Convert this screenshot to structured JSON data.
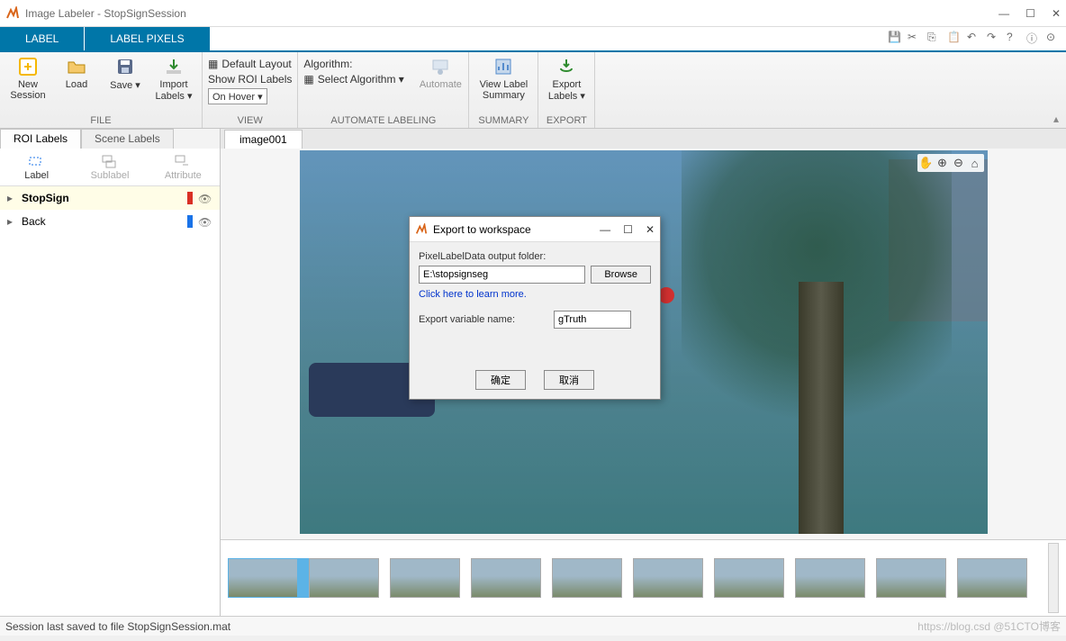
{
  "window": {
    "title": "Image Labeler - StopSignSession",
    "min": "—",
    "max": "☐",
    "close": "✕"
  },
  "tabs": {
    "label": "LABEL",
    "pixels": "LABEL PIXELS"
  },
  "ribbon": {
    "file": {
      "new": "New\nSession",
      "load": "Load",
      "save": "Save ▾",
      "import": "Import\nLabels ▾",
      "group": "FILE"
    },
    "view": {
      "default_layout": "Default Layout",
      "show_roi": "Show ROI Labels",
      "on_hover": "On Hover ▾",
      "group": "VIEW"
    },
    "auto": {
      "algo_header": "Algorithm:",
      "select": "Select Algorithm ▾",
      "automate": "Automate",
      "group": "AUTOMATE LABELING"
    },
    "summary": {
      "view": "View Label\nSummary",
      "group": "SUMMARY"
    },
    "export": {
      "export": "Export\nLabels ▾",
      "group": "EXPORT"
    }
  },
  "left": {
    "tab_roi": "ROI Labels",
    "tab_scene": "Scene Labels",
    "tool_label": "Label",
    "tool_sub": "Sublabel",
    "tool_attr": "Attribute",
    "items": [
      {
        "name": "StopSign",
        "color": "#d93025"
      },
      {
        "name": "Back",
        "color": "#1a73e8"
      }
    ]
  },
  "canvas": {
    "tab": "image001"
  },
  "nav": {
    "pan": "✋",
    "zin": "⊕",
    "zout": "⊖",
    "home": "⌂"
  },
  "dialog": {
    "title": "Export to workspace",
    "outlabel": "PixelLabelData output folder:",
    "path": "E:\\stopsignseg",
    "browse": "Browse",
    "learn": "Click here to learn more.",
    "varlabel": "Export variable name:",
    "varname": "gTruth",
    "ok": "确定",
    "cancel": "取消",
    "min": "—",
    "max": "☐",
    "close": "✕"
  },
  "status": {
    "msg": "Session last saved to file StopSignSession.mat",
    "wm": "https://blog.csd @51CTO博客"
  }
}
